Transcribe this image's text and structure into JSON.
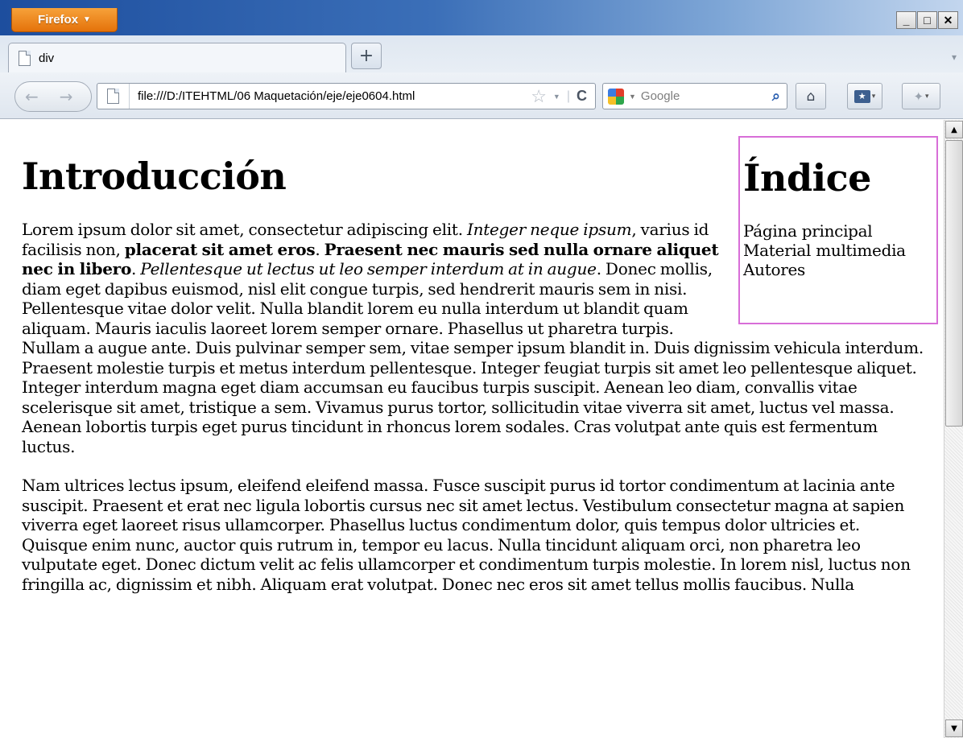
{
  "browser": {
    "menu_button": "Firefox",
    "tab_title": "div",
    "new_tab_symbol": "+",
    "address": "file:///D:/ITEHTML/06 Maquetación/eje/eje0604.html",
    "search_placeholder": "Google"
  },
  "page": {
    "title": "Introducción",
    "sidebar": {
      "title": "Índice",
      "links": [
        "Página principal",
        "Material multimedia",
        "Autores"
      ]
    },
    "paragraph1": {
      "run1": "Lorem ipsum dolor sit amet, consectetur adipiscing elit. ",
      "run2_italic": "Integer neque ipsum",
      "run3": ", varius id facilisis non, ",
      "run4_bold": "placerat sit amet eros",
      "run5": ". ",
      "run6_bold": "Praesent nec mauris sed nulla ornare aliquet nec in libero",
      "run7": ". ",
      "run8_italic": "Pellentesque ut lectus ut leo semper interdum at in augue",
      "run9": ". Donec mollis, diam eget dapibus euismod, nisl elit congue turpis, sed hendrerit mauris sem in nisi. Pellentesque vitae dolor velit. Nulla blandit lorem eu nulla interdum ut blandit quam aliquam. Mauris iaculis laoreet lorem semper ornare. Phasellus ut pharetra turpis. Nullam a augue ante. Duis pulvinar semper sem, vitae semper ipsum blandit in. Duis dignissim vehicula interdum. Praesent molestie turpis et metus interdum pellentesque. Integer feugiat turpis sit amet leo pellentesque aliquet. Integer interdum magna eget diam accumsan eu faucibus turpis suscipit. Aenean leo diam, convallis vitae scelerisque sit amet, tristique a sem. Vivamus purus tortor, sollicitudin vitae viverra sit amet, luctus vel massa. Aenean lobortis turpis eget purus tincidunt in rhoncus lorem sodales. Cras volutpat ante quis est fermentum luctus."
    },
    "paragraph2": "Nam ultrices lectus ipsum, eleifend eleifend massa. Fusce suscipit purus id tortor condimentum at lacinia ante suscipit. Praesent et erat nec ligula lobortis cursus nec sit amet lectus. Vestibulum consectetur magna at sapien viverra eget laoreet risus ullamcorper. Phasellus luctus condimentum dolor, quis tempus dolor ultricies et. Quisque enim nunc, auctor quis rutrum in, tempor eu lacus. Nulla tincidunt aliquam orci, non pharetra leo vulputate eget. Donec dictum velit ac felis ullamcorper et condimentum turpis molestie. In lorem nisl, luctus non fringilla ac, dignissim et nibh. Aliquam erat volutpat. Donec nec eros sit amet tellus mollis faucibus. Nulla"
  },
  "colors": {
    "sidebar_border": "#d86ed8",
    "menu_button": "#e4720a",
    "titlebar": "#1d4e9e"
  },
  "icons": [
    "page-icon",
    "back-icon",
    "forward-icon",
    "star-icon",
    "reload-icon",
    "google-icon",
    "search-icon",
    "home-icon",
    "bookmarks-icon",
    "addons-icon",
    "minimize-icon",
    "maximize-icon",
    "close-icon"
  ]
}
